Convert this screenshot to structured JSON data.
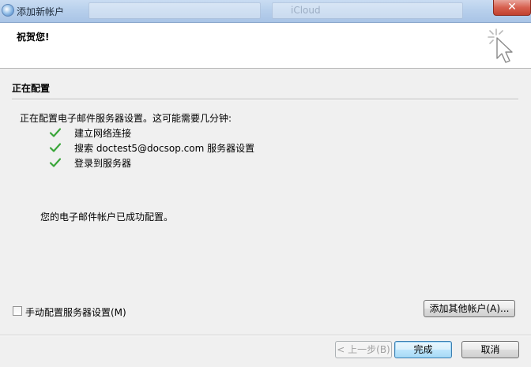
{
  "window": {
    "title": "添加新帐户",
    "background_text": "iCloud"
  },
  "header": {
    "title": "祝贺您!"
  },
  "section": {
    "title": "正在配置",
    "intro": "正在配置电子邮件服务器设置。这可能需要几分钟:",
    "steps": [
      {
        "label": "建立网络连接",
        "status": "done"
      },
      {
        "label": "搜索 doctest5@docsop.com 服务器设置",
        "status": "done"
      },
      {
        "label": "登录到服务器",
        "status": "done"
      }
    ],
    "success": "您的电子邮件帐户已成功配置。"
  },
  "options": {
    "manual_config_label": "手动配置服务器设置(M)",
    "manual_config_checked": false,
    "add_other_account_label": "添加其他帐户(A)..."
  },
  "buttons": {
    "back_label": "< 上一步(B)",
    "finish_label": "完成",
    "cancel_label": "取消"
  },
  "colors": {
    "check": "#3aa63a",
    "default_button_border": "#3c7fb1",
    "close_button": "#c1412f"
  }
}
